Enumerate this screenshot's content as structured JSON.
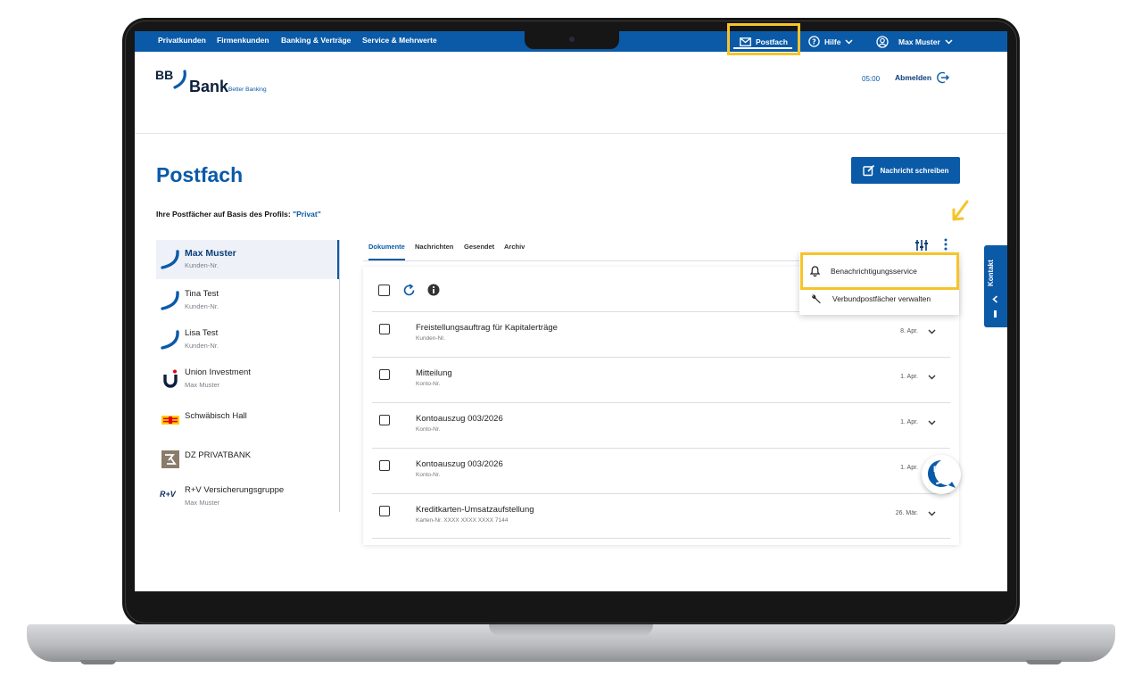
{
  "topnav": {
    "items": [
      "Privatkunden",
      "Firmenkunden",
      "Banking & Verträge",
      "Service & Mehrwerte"
    ],
    "postfach": "Postfach",
    "hilfe": "Hilfe",
    "user": "Max Muster"
  },
  "header": {
    "logo_bb": "BB",
    "logo_bank": "Bank",
    "logo_tagline": "Better Banking",
    "timer": "05:00",
    "logout": "Abmelden"
  },
  "page": {
    "title": "Postfach",
    "compose_button": "Nachricht schreiben",
    "profile_prefix": "Ihre Postfächer auf Basis des Profils:",
    "profile_value": "\"Privat\""
  },
  "sidebar": {
    "items": [
      {
        "name": "Max Muster",
        "sub": "Kunden-Nr.",
        "icon": "bb-swoosh-icon",
        "active": true
      },
      {
        "name": "Tina Test",
        "sub": "Kunden-Nr.",
        "icon": "bb-swoosh-icon"
      },
      {
        "name": "Lisa Test",
        "sub": "Kunden-Nr.",
        "icon": "bb-swoosh-icon"
      },
      {
        "name": "Union Investment",
        "sub": "Max Muster",
        "icon": "union-investment-icon"
      },
      {
        "name": "Schwäbisch Hall",
        "sub": "",
        "icon": "schwaebisch-hall-icon"
      },
      {
        "name": "DZ PRIVATBANK",
        "sub": "",
        "icon": "dz-privatbank-icon"
      },
      {
        "name": "R+V Versicherungsgruppe",
        "sub": "Max Muster",
        "icon": "ruv-icon"
      }
    ],
    "ruv_logo": "R+V"
  },
  "tabs": [
    "Dokumente",
    "Nachrichten",
    "Gesendet",
    "Archiv"
  ],
  "menu": {
    "items": [
      "Benachrichtigungsservice",
      "Verbundpostfächer verwalten"
    ]
  },
  "documents": [
    {
      "title": "Freistellungsauftrag für Kapitalerträge",
      "sub": "Kunden-Nr.",
      "date": "8. Apr."
    },
    {
      "title": "Mitteilung",
      "sub": "Konto-Nr.",
      "date": "1. Apr."
    },
    {
      "title": "Kontoauszug 003/2026",
      "sub": "Konto-Nr.",
      "date": "1. Apr."
    },
    {
      "title": "Kontoauszug 003/2026",
      "sub": "Konto-Nr.",
      "date": "1. Apr."
    },
    {
      "title": "Kreditkarten-Umsatzaufstellung",
      "sub": "Karten-Nr. XXXX XXXX XXXX 7144",
      "date": "26. Mär."
    }
  ],
  "kontakt": "Kontakt",
  "chat_label": "BB",
  "colors": {
    "brand_blue": "#0a5aa8",
    "highlight_yellow": "#f6c42a"
  }
}
